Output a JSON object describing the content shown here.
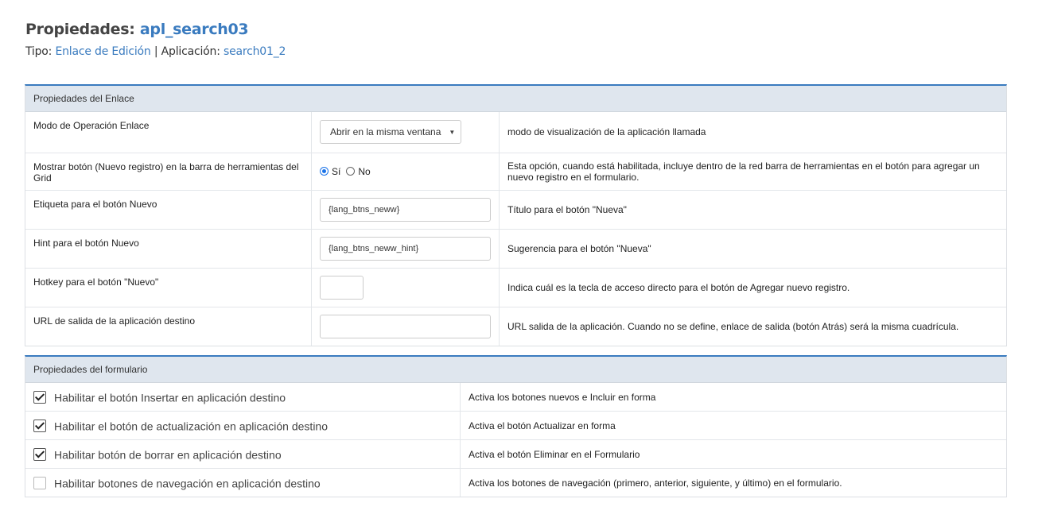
{
  "header": {
    "title_prefix": "Propiedades:",
    "title_app": "apl_search03",
    "tipo_label": "Tipo:",
    "tipo_value": "Enlace de Edición",
    "separator": "|",
    "app_label": "Aplicación:",
    "app_value": "search01_2"
  },
  "link_panel": {
    "title": "Propiedades del Enlace",
    "rows": [
      {
        "label": "Modo de Operación Enlace",
        "control": "Abrir en la misma ventana",
        "description": "modo de visualización de la aplicación llamada"
      },
      {
        "label": "Mostrar botón (Nuevo registro) en la barra de herramientas del Grid",
        "radio_yes": "Sí",
        "radio_no": "No",
        "selected": "Sí",
        "description": "Esta opción, cuando está habilitada, incluye dentro de la red barra de herramientas en el botón para agregar un nuevo registro en el formulario."
      },
      {
        "label": "Etiqueta para el botón Nuevo",
        "control": "{lang_btns_neww}",
        "description": "Título para el botón \"Nueva\""
      },
      {
        "label": "Hint para el botón Nuevo",
        "control": "{lang_btns_neww_hint}",
        "description": "Sugerencia para el botón \"Nueva\""
      },
      {
        "label": "Hotkey para el botón \"Nuevo\"",
        "control": "",
        "description": "Indica cuál es la tecla de acceso directo para el botón de Agregar nuevo registro."
      },
      {
        "label": "URL de salida de la aplicación destino",
        "control": "",
        "description": "URL salida de la aplicación. Cuando no se define, enlace de salida (botón Atrás) será la misma cuadrícula."
      }
    ]
  },
  "form_panel": {
    "title": "Propiedades del formulario",
    "rows": [
      {
        "label": "Habilitar el botón Insertar en aplicación destino",
        "checked": true,
        "description": "Activa los botones nuevos e Incluir en forma"
      },
      {
        "label": "Habilitar el botón de actualización en aplicación destino",
        "checked": true,
        "description": "Activa el botón Actualizar en forma"
      },
      {
        "label": "Habilitar botón de borrar en aplicación destino",
        "checked": true,
        "description": "Activa el botón Eliminar en el Formulario"
      },
      {
        "label": "Habilitar botones de navegación en aplicación destino",
        "checked": false,
        "description": "Activa los botones de navegación (primero, anterior, siguiente, y último) en el formulario."
      }
    ]
  },
  "colors": {
    "accent": "#3a7bbf",
    "panel_header_bg": "#dfe6ee",
    "radio_selected": "#1a73e8"
  },
  "icons": {
    "dropdown": "caret-down-icon",
    "check": "checkmark-icon"
  }
}
